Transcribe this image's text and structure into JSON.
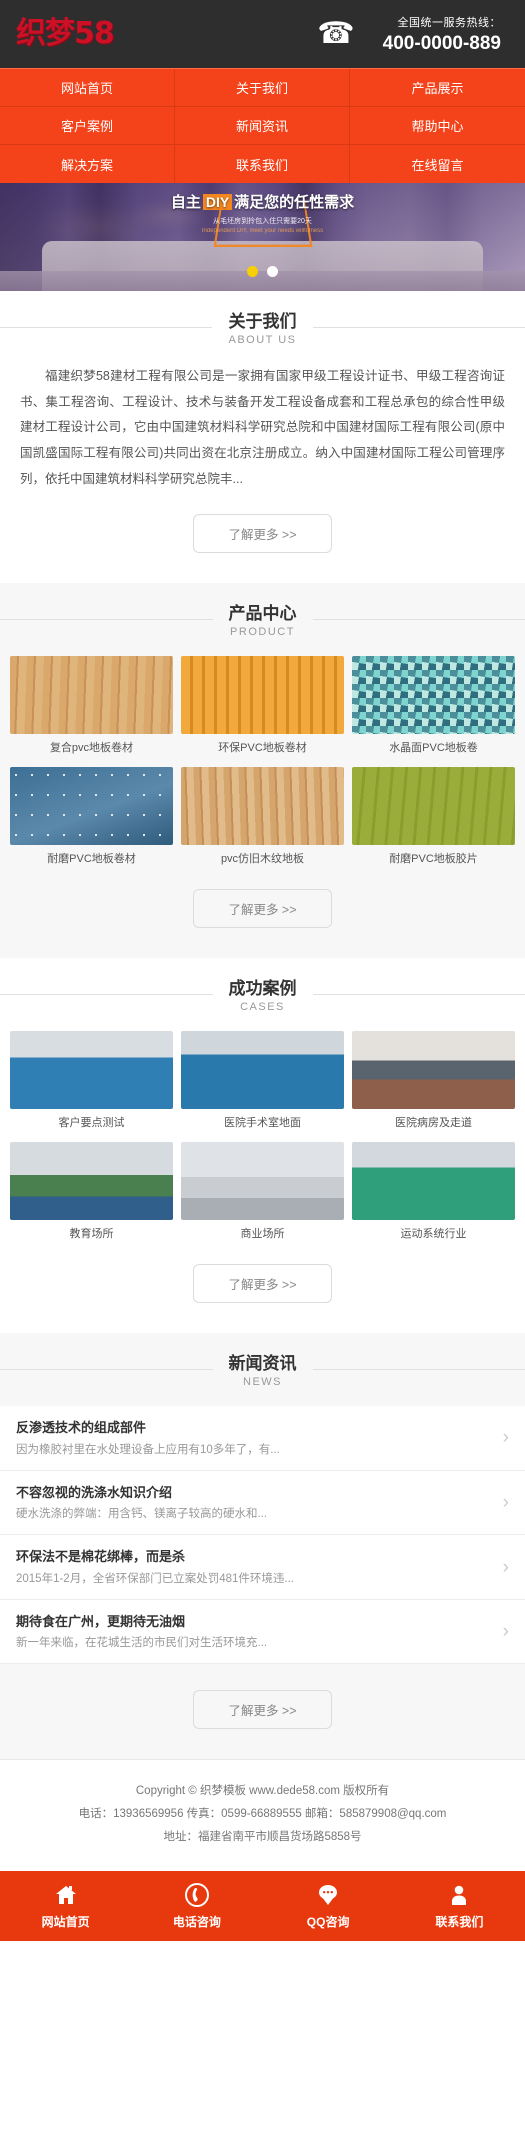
{
  "header": {
    "logo_text": "织梦58",
    "phone_icon": "telephone-icon",
    "hotline_label": "全国统一服务热线：",
    "hotline_number": "400-0000-889",
    "brand_red": "#cc1026",
    "bar_bg": "#2e2e2e"
  },
  "nav": {
    "accent": "#f4421a",
    "items": [
      {
        "label": "网站首页"
      },
      {
        "label": "关于我们"
      },
      {
        "label": "产品展示"
      },
      {
        "label": "客户案例"
      },
      {
        "label": "新闻资讯"
      },
      {
        "label": "帮助中心"
      },
      {
        "label": "解决方案"
      },
      {
        "label": "联系我们"
      },
      {
        "label": "在线留言"
      }
    ]
  },
  "banner": {
    "title_pre": "自主",
    "title_diy": "DIY",
    "title_post": "满足您的任性需求",
    "sub_cn": "从毛坯房到拎包入住只需要20天",
    "sub_en": "Independent DIY, meet your needs willfulness",
    "dots": [
      {
        "active": true
      },
      {
        "active": false
      }
    ],
    "active_dot_color": "#f7d000"
  },
  "about": {
    "title": "关于我们",
    "subtitle": "ABOUT US",
    "body": "福建织梦58建材工程有限公司是一家拥有国家甲级工程设计证书、甲级工程咨询证书、集工程咨询、工程设计、技术与装备开发工程设备成套和工程总承包的综合性甲级建材工程设计公司，它由中国建筑材料科学研究总院和中国建材国际工程有限公司(原中国凯盛国际工程有限公司)共同出资在北京注册成立。纳入中国建材国际工程公司管理序列，依托中国建筑材料科学研究总院丰...",
    "more_label": "了解更多 >>"
  },
  "product": {
    "title": "产品中心",
    "subtitle": "PRODUCT",
    "more_label": "了解更多 >>",
    "items": [
      {
        "label": "复合pvc地板卷材",
        "tex": "p0"
      },
      {
        "label": "环保PVC地板卷材",
        "tex": "p1"
      },
      {
        "label": "水晶面PVC地板卷",
        "tex": "p3"
      },
      {
        "label": "耐磨PVC地板卷材",
        "tex": "p4"
      },
      {
        "label": "pvc仿旧木纹地板",
        "tex": "p5"
      },
      {
        "label": "耐磨PVC地板胶片",
        "tex": "p6"
      }
    ]
  },
  "cases": {
    "title": "成功案例",
    "subtitle": "CASES",
    "more_label": "了解更多 >>",
    "items": [
      {
        "label": "客户要点测试",
        "tex": "c0"
      },
      {
        "label": "医院手术室地面",
        "tex": "c1"
      },
      {
        "label": "医院病房及走道",
        "tex": "c2"
      },
      {
        "label": "教育场所",
        "tex": "c3"
      },
      {
        "label": "商业场所",
        "tex": "c4"
      },
      {
        "label": "运动系统行业",
        "tex": "c5"
      }
    ]
  },
  "news": {
    "title": "新闻资讯",
    "subtitle": "NEWS",
    "more_label": "了解更多 >>",
    "arrow": "›",
    "items": [
      {
        "title": "反渗透技术的组成部件",
        "desc": "因为橡胶衬里在水处理设备上应用有10多年了，有..."
      },
      {
        "title": "不容忽视的洗涤水知识介绍",
        "desc": "硬水洗涤的弊端：用含钙、镁离子较高的硬水和..."
      },
      {
        "title": "环保法不是棉花绑棒，而是杀",
        "desc": "2015年1-2月，全省环保部门已立案处罚481件环境违..."
      },
      {
        "title": "期待食在广州，更期待无油烟",
        "desc": "新一年来临，在花城生活的市民们对生活环境充..."
      }
    ]
  },
  "footer": {
    "copyright": "Copyright © 织梦模板 www.dede58.com 版权所有",
    "contact": "电话：13936569956 传真：0599-66889555 邮箱：585879908@qq.com",
    "address": "地址：福建省南平市顺昌货场路5858号"
  },
  "bottombar": {
    "bg": "#e8380d",
    "items": [
      {
        "label": "网站首页",
        "icon": "home-icon"
      },
      {
        "label": "电话咨询",
        "icon": "phone-icon"
      },
      {
        "label": "QQ咨询",
        "icon": "chat-bubble-icon"
      },
      {
        "label": "联系我们",
        "icon": "user-icon"
      }
    ]
  }
}
